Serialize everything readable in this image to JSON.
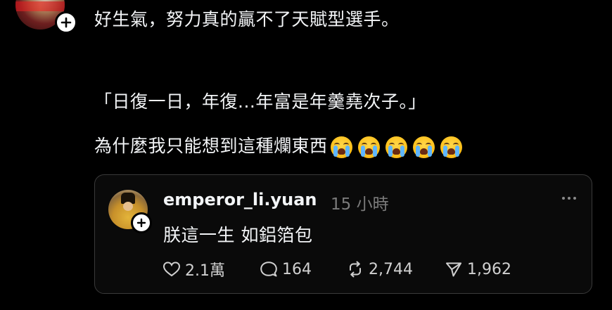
{
  "post": {
    "line1": "好生氣，努力真的贏不了天賦型選手。",
    "line2": "「日復一日，年復...年富是年羹堯次子。」",
    "line3": "為什麼我只能想到這種爛東西",
    "emojis": [
      "loudly-crying-face-emoji",
      "loudly-crying-face-emoji",
      "loudly-crying-face-emoji",
      "loudly-crying-face-emoji",
      "loudly-crying-face-emoji"
    ]
  },
  "quote": {
    "username": "emperor_li.yuan",
    "time": "15 小時",
    "body": "朕這一生 如鋁箔包",
    "likes": "2.1萬",
    "replies": "164",
    "reposts": "2,744",
    "shares": "1,962"
  },
  "colors": {
    "background": "#000000",
    "text": "#f3f5f7",
    "muted": "#7b7b7b",
    "card_border": "#3a3a3a"
  }
}
